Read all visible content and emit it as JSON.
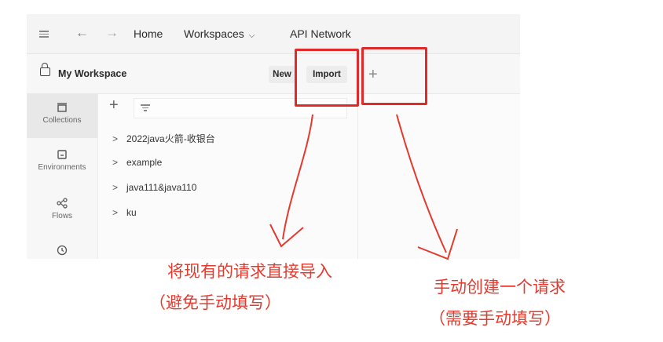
{
  "topbar": {
    "back_arrow": "←",
    "forward_arrow": "→",
    "nav": [
      {
        "label": "Home"
      },
      {
        "label": "Workspaces"
      },
      {
        "label": "API Network"
      }
    ]
  },
  "workspace": {
    "title": "My Workspace",
    "new_label": "New",
    "import_label": "Import",
    "new_tab_symbol": "+"
  },
  "sidebar": {
    "items": [
      {
        "label": "Collections",
        "icon": "collections-icon"
      },
      {
        "label": "Environments",
        "icon": "environments-icon"
      },
      {
        "label": "Flows",
        "icon": "flows-icon"
      },
      {
        "label": "",
        "icon": "history-icon"
      }
    ]
  },
  "panel": {
    "add_symbol": "+",
    "collections": [
      {
        "name": "2022java火箭-收银台"
      },
      {
        "name": "example"
      },
      {
        "name": "java111&java110"
      },
      {
        "name": "ku"
      }
    ]
  },
  "annotations": {
    "left_line1": "将现有的请求直接导入",
    "left_line2": "（避免手动填写）",
    "right_line1": "手动创建一个请求",
    "right_line2": "（需要手动填写）",
    "color": "#e43a2e"
  }
}
